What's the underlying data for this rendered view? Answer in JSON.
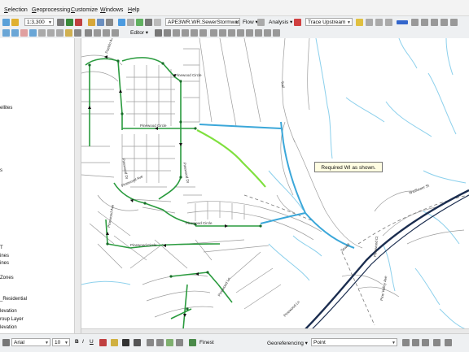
{
  "menu": [
    "Selection",
    "Geoprocessing",
    "Customize",
    "Windows",
    "Help"
  ],
  "toolbar": {
    "scale": "1:3,300",
    "layer_dropdown": "APE3WR.WR.SewerStormwat",
    "flow_label": "Flow ▾",
    "analysis_label": "Analysis ▾",
    "trace_dropdown": "Trace Upstream",
    "editor_label": "Editor ▾"
  },
  "toc": {
    "partial_items": [
      "ellites",
      "s",
      "T",
      "ines",
      "ines",
      "Zones",
      "_Residential",
      "levation",
      "roup Layer",
      "levation"
    ]
  },
  "map": {
    "callout_text": "Required WI as shown.",
    "street_labels": [
      "Pueblo Ave",
      "Pinewood Circle",
      "Pinewood Circle",
      "Pinewood Circle",
      "Pinewood Circle",
      "Wildflower St",
      "Trail",
      "Pinewood Dr",
      "Pinewood Dr",
      "Sewell",
      "Pinewood Ct",
      "Pine Valley Ave",
      "Pinewood Ave",
      "Pinewood Ave",
      "Pinewood Ln",
      "Pinewood Ln"
    ],
    "colors": {
      "sewer": "#2a9b3e",
      "storm": "#3ba7d9",
      "required": "#7fe03e",
      "road": "#1b2d4f",
      "water": "#8cd0ec",
      "parcel": "#9a9a9a"
    }
  },
  "drawing": {
    "font": "Arial",
    "size": "10",
    "bold": "B",
    "italic": "I",
    "underline": "U",
    "smoothing": "Finest",
    "georef_label": "Georeferencing ▾",
    "point_dropdown": "Point"
  }
}
